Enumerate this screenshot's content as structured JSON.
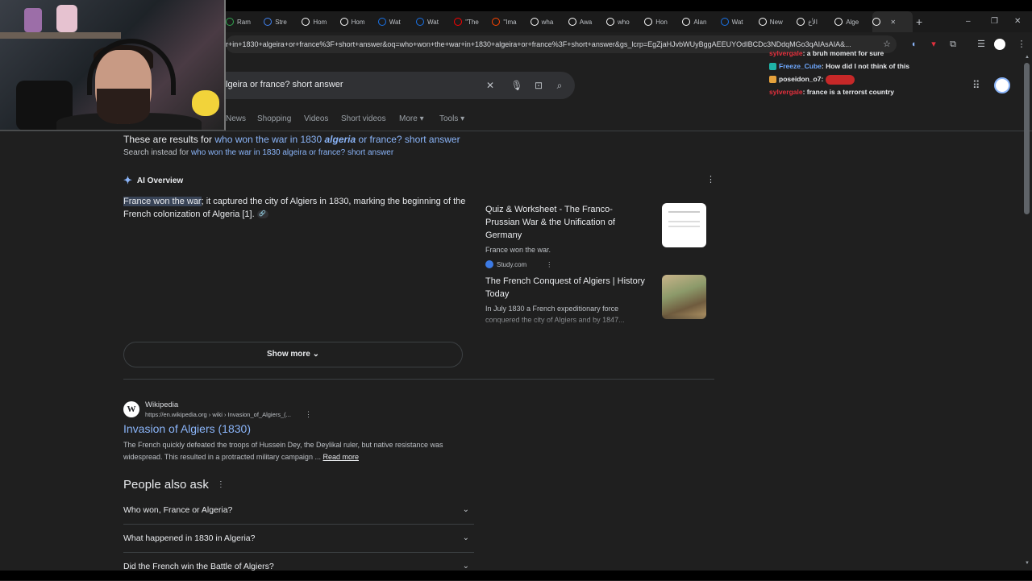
{
  "browser": {
    "tabs": [
      {
        "label": "Ram",
        "icon": "chrome-favicon",
        "color": "#34a853"
      },
      {
        "label": "Stre",
        "icon": "stream-favicon",
        "color": "#4285f4"
      },
      {
        "label": "Hom",
        "icon": "x-favicon",
        "color": "#ffffff"
      },
      {
        "label": "Hom",
        "icon": "x-favicon",
        "color": "#ffffff"
      },
      {
        "label": "Wat",
        "icon": "watch-favicon",
        "color": "#1a73e8"
      },
      {
        "label": "Wat",
        "icon": "watch-favicon",
        "color": "#1a73e8"
      },
      {
        "label": "\"The",
        "icon": "youtube-favicon",
        "color": "#ff0000"
      },
      {
        "label": "\"Ima",
        "icon": "reddit-favicon",
        "color": "#ff4500"
      },
      {
        "label": "wha",
        "icon": "google-favicon",
        "color": "#ffffff"
      },
      {
        "label": "Awa",
        "icon": "x-favicon",
        "color": "#ffffff"
      },
      {
        "label": "who",
        "icon": "google-favicon",
        "color": "#ffffff"
      },
      {
        "label": "Hon",
        "icon": "x-favicon",
        "color": "#ffffff"
      },
      {
        "label": "Alan",
        "icon": "x-favicon",
        "color": "#ffffff"
      },
      {
        "label": "Wat",
        "icon": "watch-favicon",
        "color": "#1a73e8"
      },
      {
        "label": "New",
        "icon": "openai-favicon",
        "color": "#ffffff"
      },
      {
        "label": "الأخ",
        "icon": "x-favicon",
        "color": "#ffffff"
      },
      {
        "label": "Alge",
        "icon": "tiktok-favicon",
        "color": "#ffffff"
      },
      {
        "label": "",
        "icon": "google-favicon",
        "color": "#ffffff",
        "active": true
      }
    ],
    "url": "r+in+1830+algeira+or+france%3F+short+answer&oq=who+won+the+war+in+1830+algeira+or+france%3F+short+answer&gs_lcrp=EgZjaHJvbWUyBggAEEUYOdIBCDc3NDdqMGo3qAIAsAIA&..."
  },
  "chat": [
    {
      "name": "sylvergale",
      "text": ": a bruh moment for sure",
      "name_color": "#e5303d"
    },
    {
      "name": "Freeze_Cube",
      "text": ": How did I not think of this",
      "name_color": "#6ea8ff"
    },
    {
      "name": "poseidon_o7",
      "text": ":",
      "name_color": "#e8eaed"
    },
    {
      "name": "sylvergale",
      "text": ": france is a terrorst country",
      "name_color": "#e5303d"
    }
  ],
  "search": {
    "query": "lgeira or france? short answer"
  },
  "nav": {
    "news": "News",
    "shopping": "Shopping",
    "videos": "Videos",
    "short_videos": "Short videos",
    "more": "More",
    "tools": "Tools"
  },
  "spelling": {
    "prefix": "These are results for",
    "corrected_a": "who won the war in 1830",
    "corrected_b": "algeria",
    "corrected_c": "or france? short answer",
    "instead_prefix": "Search instead for",
    "original": "who won the war in 1830 algeira or france? short answer"
  },
  "ai_overview": {
    "label": "AI Overview",
    "highlight": "France won the war",
    "rest": "; it captured the city of Algiers in 1830, marking the beginning of the French colonization of Algeria [1].",
    "show_more": "Show more",
    "cards": [
      {
        "title": "Quiz & Worksheet - The Franco-Prussian War & the Unification of Germany",
        "snippet": "France won the war.",
        "source": "Study.com"
      },
      {
        "title": "The French Conquest of Algiers | History Today",
        "snippet": "In July 1830 a French expeditionary force conquered the city of Algiers and by 1847..."
      }
    ]
  },
  "wiki_result": {
    "site": "Wikipedia",
    "url": "https://en.wikipedia.org › wiki › Invasion_of_Algiers_(...",
    "title": "Invasion of Algiers (1830)",
    "snippet": "The French quickly defeated the troops of Hussein Dey, the Deylikal ruler, but native resistance was widespread. This resulted in a protracted military campaign ...",
    "read_more": "Read more"
  },
  "paa": {
    "heading": "People also ask",
    "questions": [
      "Who won, France or Algeria?",
      "What happened in 1830 in Algeria?",
      "Did the French win the Battle of Algiers?"
    ]
  }
}
